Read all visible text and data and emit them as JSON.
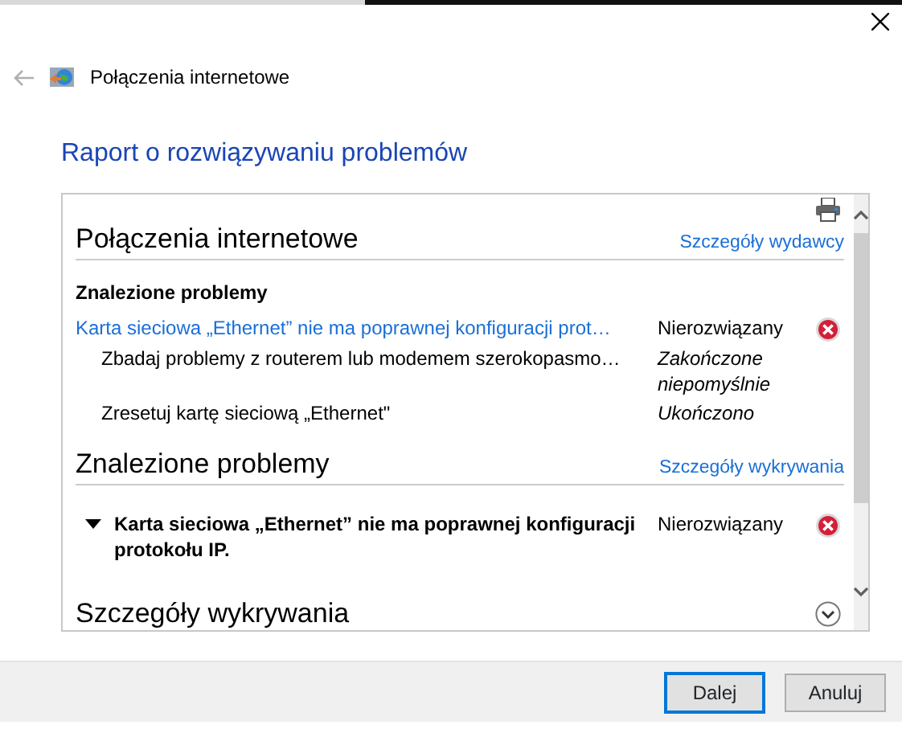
{
  "window": {
    "title": "Połączenia internetowe"
  },
  "heading": "Raport o rozwiązywaniu problemów",
  "sections": [
    {
      "title": "Połączenia internetowe",
      "link": "Szczegóły wydawcy",
      "subheading": "Znalezione problemy",
      "rows": [
        {
          "kind": "link",
          "text": "Karta sieciowa „Ethernet” nie ma poprawnej konfiguracji prot…",
          "status": "Nierozwiązany",
          "error": true
        },
        {
          "kind": "step",
          "text": "Zbadaj problemy z routerem lub modemem szerokopasmo…",
          "status": "Zakończone niepomyślnie",
          "error": false
        },
        {
          "kind": "step",
          "text": "Zresetuj kartę sieciową „Ethernet\"",
          "status": "Ukończono",
          "error": false
        }
      ]
    },
    {
      "title": "Znalezione problemy",
      "link": "Szczegóły wykrywania",
      "rows": [
        {
          "kind": "expandable",
          "text": "Karta sieciowa „Ethernet” nie ma poprawnej konfiguracji protokołu IP.",
          "status": "Nierozwiązany",
          "error": true,
          "expanded": true
        }
      ]
    }
  ],
  "collapsed_section": {
    "title": "Szczegóły wykrywania",
    "expanded": false
  },
  "buttons": [
    {
      "label": "Dalej",
      "default": true
    },
    {
      "label": "Anuluj",
      "default": false
    }
  ]
}
